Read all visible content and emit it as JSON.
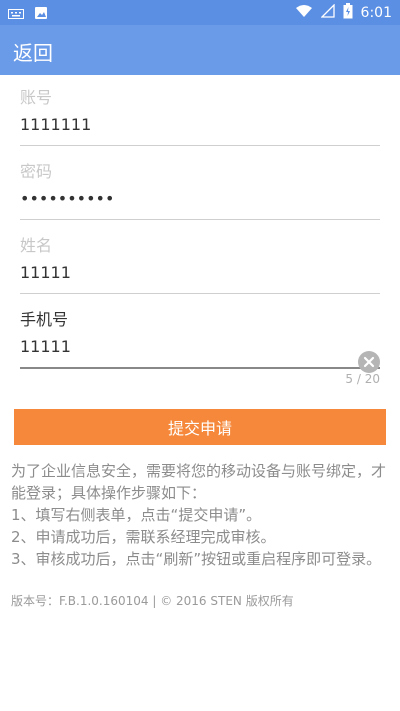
{
  "statusbar": {
    "time": "6:01"
  },
  "appbar": {
    "back_label": "返回"
  },
  "form": {
    "account": {
      "label": "账号",
      "value": "1111111"
    },
    "password": {
      "label": "密码",
      "value": "••••••••••"
    },
    "name": {
      "label": "姓名",
      "value": "11111"
    },
    "phone": {
      "label": "手机号",
      "value": "11111",
      "counter": "5 / 20"
    }
  },
  "submit_label": "提交申请",
  "notice": {
    "intro": "为了企业信息安全，需要将您的移动设备与账号绑定，才能登录；具体操作步骤如下：",
    "step1": "1、填写右侧表单，点击“提交申请”。",
    "step2": "2、申请成功后，需联系经理完成审核。",
    "step3": "3、审核成功后，点击“刷新”按钮或重启程序即可登录。"
  },
  "version": "版本号：F.B.1.0.160104 | © 2016 STEN 版权所有",
  "colors": {
    "appbar": "#6a9be8",
    "statusbar": "#5b8fe3",
    "accent": "#f5883a"
  },
  "icons": [
    "keyboard-icon",
    "image-icon",
    "wifi-icon",
    "signal-icon",
    "battery-icon",
    "clear-icon"
  ]
}
